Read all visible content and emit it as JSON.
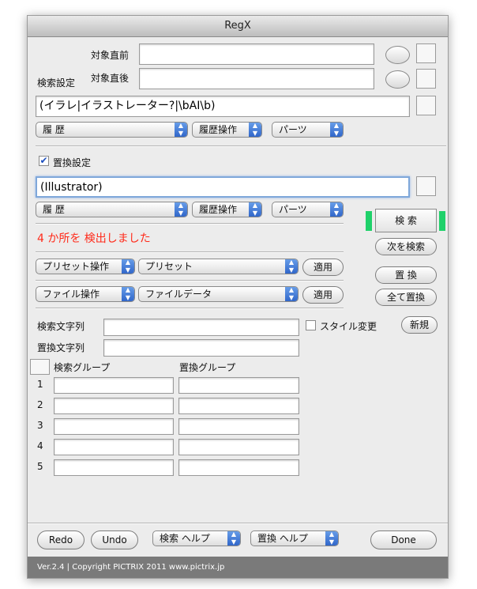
{
  "window": {
    "title": "RegX"
  },
  "search": {
    "label_before": "対象直前",
    "label_after": "対象直後",
    "settings_label": "検索設定",
    "pattern": "(イラレ|イラストレーター?|\\bAI\\b)",
    "history": "履 歴",
    "history_ops": "履歴操作",
    "parts": "パーツ"
  },
  "replace": {
    "checkbox_label": "置換設定",
    "checked": true,
    "pattern": "(Illustrator)",
    "history": "履 歴",
    "history_ops": "履歴操作",
    "parts": "パーツ"
  },
  "status": "4 か所を 検出しました",
  "preset": {
    "ops": "プリセット操作",
    "select": "プリセット",
    "apply": "適用"
  },
  "file": {
    "ops": "ファイル操作",
    "select": "ファイルデータ",
    "apply": "適用"
  },
  "actions": {
    "search": "検 索",
    "find_next": "次を検索",
    "replace": "置 換",
    "replace_all": "全て置換",
    "new": "新規"
  },
  "strings": {
    "search_label": "検索文字列",
    "replace_label": "置換文字列",
    "style_change": "スタイル変更"
  },
  "groups": {
    "search_header": "検索グループ",
    "replace_header": "置換グループ",
    "rows": [
      "1",
      "2",
      "3",
      "4",
      "5"
    ]
  },
  "bottom": {
    "redo": "Redo",
    "undo": "Undo",
    "search_help": "検索 ヘルプ",
    "replace_help": "置換 ヘルプ",
    "done": "Done"
  },
  "footer": "Ver.2.4 | Copyright PICTRIX 2011 www.pictrix.jp",
  "colors": {
    "status": "#ff2a1a",
    "indicator": "#1fd16a",
    "accent": "#2d63c8"
  }
}
